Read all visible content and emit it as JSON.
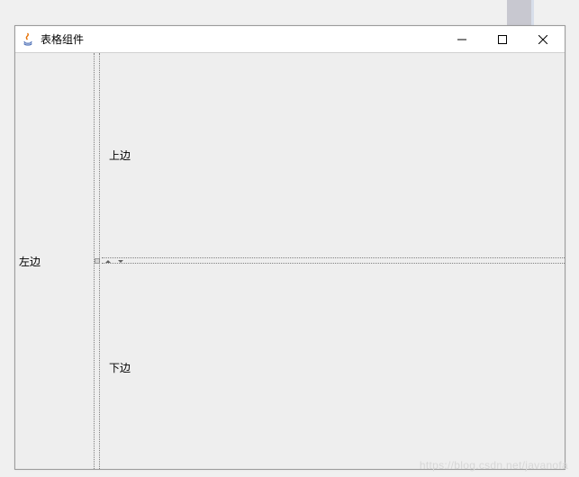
{
  "window": {
    "title": "表格组件"
  },
  "panels": {
    "left_label": "左边",
    "top_label": "上边",
    "bottom_label": "下边"
  },
  "watermark": "https://blog.csdn.net/javanofa"
}
